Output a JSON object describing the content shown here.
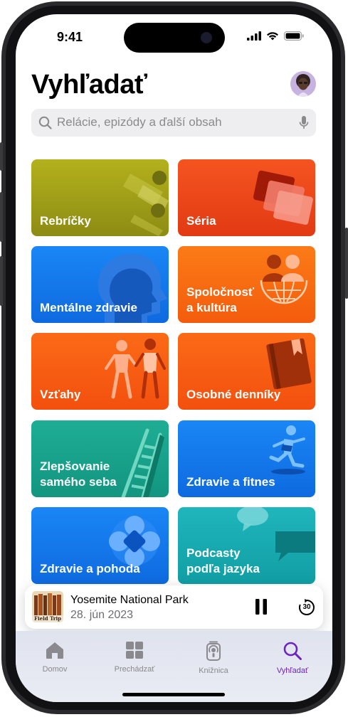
{
  "status": {
    "time": "9:41"
  },
  "header": {
    "title": "Vyhľadať"
  },
  "search": {
    "placeholder": "Relácie, epizódy a ďalší obsah"
  },
  "categories": [
    {
      "label1": "Rebríčky",
      "label2": ""
    },
    {
      "label1": "Séria",
      "label2": ""
    },
    {
      "label1": "Mentálne zdravie",
      "label2": ""
    },
    {
      "label1": "Spoločnosť",
      "label2": "a kultúra"
    },
    {
      "label1": "Vzťahy",
      "label2": ""
    },
    {
      "label1": "Osobné denníky",
      "label2": ""
    },
    {
      "label1": "Zlepšovanie",
      "label2": "samého seba"
    },
    {
      "label1": "Zdravie a fitnes",
      "label2": ""
    },
    {
      "label1": "Zdravie a pohoda",
      "label2": ""
    },
    {
      "label1": "Podcasty",
      "label2": "podľa jazyka"
    }
  ],
  "colors": {
    "olive": "#a6a51a",
    "red_orange": "#f2441a",
    "blue": "#1577f0",
    "orange": "#f7640f",
    "teal": "#1aa48d",
    "cyan": "#16aeb4",
    "accent_purple": "#6f22c2"
  },
  "mini_player": {
    "title": "Yosemite National Park",
    "subtitle": "28. jún 2023",
    "artwork_text": "Field Trip",
    "skip_seconds": "30"
  },
  "tabs": [
    {
      "label": "Domov",
      "icon": "house-icon"
    },
    {
      "label": "Prechádzať",
      "icon": "grid-icon"
    },
    {
      "label": "Knižnica",
      "icon": "podcast-library-icon"
    },
    {
      "label": "Vyhľadať",
      "icon": "magnifier-icon",
      "active": true
    }
  ]
}
